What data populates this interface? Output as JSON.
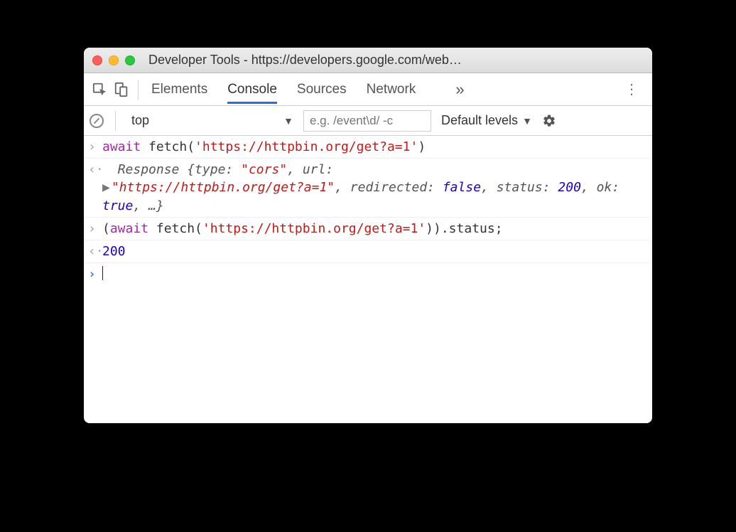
{
  "window": {
    "title": "Developer Tools - https://developers.google.com/web…"
  },
  "tabs": {
    "elements": "Elements",
    "console": "Console",
    "sources": "Sources",
    "network": "Network",
    "more": "»"
  },
  "filter": {
    "context": "top",
    "placeholder": "e.g. /event\\d/ -c",
    "levels": "Default levels"
  },
  "console": {
    "line1": {
      "await": "await",
      "fn": " fetch(",
      "arg": "'https://httpbin.org/get?a=1'",
      "close": ")"
    },
    "line2": {
      "prefix": "Response ",
      "open": "{",
      "k_type": "type: ",
      "v_type": "\"cors\"",
      "k_url": ", url:",
      "v_url": "\"https://httpbin.org/get?a=1\"",
      "k_redir": ", redirected: ",
      "v_redir": "false",
      "k_status": ", status: ",
      "v_status": "200",
      "k_ok": ", ok: ",
      "v_ok": "true",
      "tail": ", …}"
    },
    "line3": {
      "open": "(",
      "await": "await",
      "fn": " fetch(",
      "arg": "'https://httpbin.org/get?a=1'",
      "close": ")).status;"
    },
    "line4": "200"
  }
}
